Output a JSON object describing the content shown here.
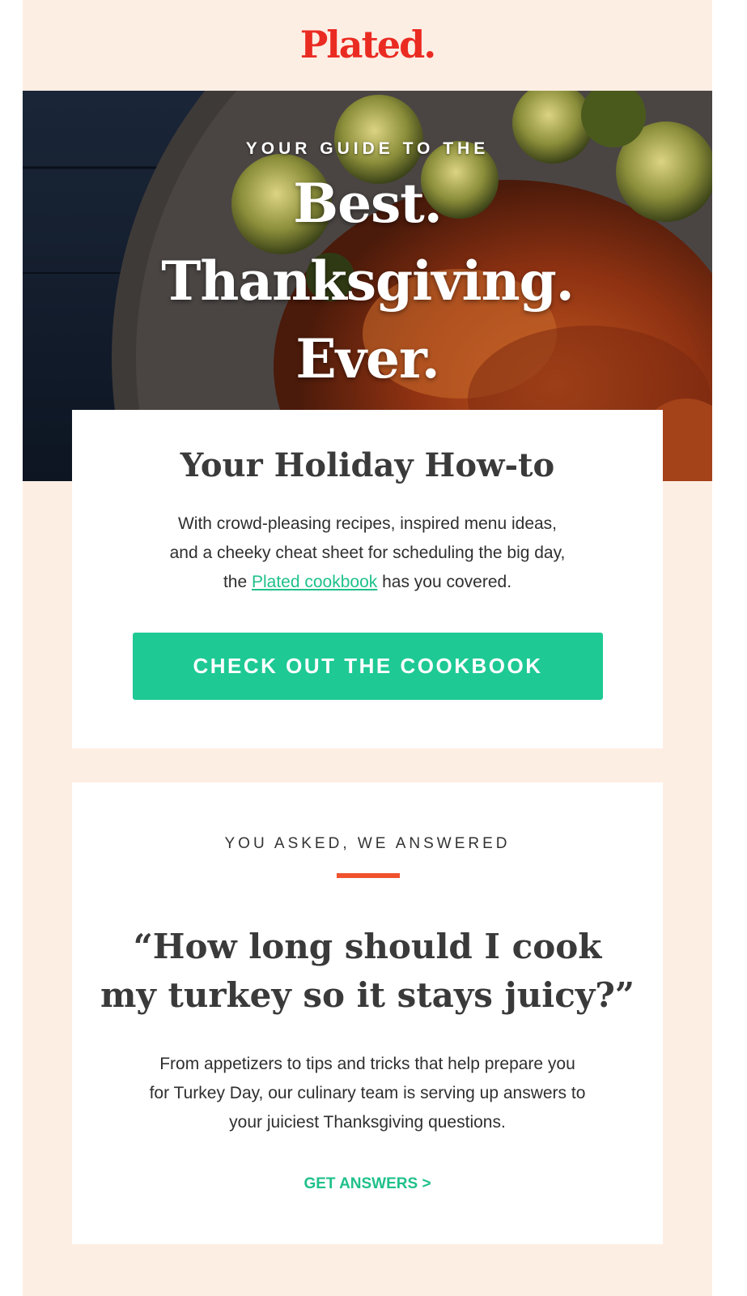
{
  "brand": {
    "logo": "Plated.",
    "color": "#ea2b22",
    "accent": "#1ec994"
  },
  "hero": {
    "eyebrow": "YOUR GUIDE TO THE",
    "line1": "Best.",
    "line2": "Thanksgiving.",
    "line3": "Ever.",
    "image_icon": "roast-turkey-brussels-sprouts-image"
  },
  "holiday": {
    "title": "Your Holiday How-to",
    "line1": "With crowd-pleasing recipes, inspired menu ideas,",
    "line2": "and a cheeky cheat sheet for scheduling the big day,",
    "line3_before": "the ",
    "line3_link": "Plated cookbook",
    "line3_after": " has you covered.",
    "cta": "CHECK OUT THE COOKBOOK"
  },
  "faq": {
    "eyebrow": "YOU ASKED, WE ANSWERED",
    "quote1": "“How long should I cook",
    "quote2": "my turkey so it stays juicy?”",
    "line1": "From appetizers to tips and tricks that help prepare you",
    "line2": "for Turkey Day, our culinary team is serving up answers to",
    "line3": "your juiciest Thanksgiving questions.",
    "link": "GET ANSWERS >"
  }
}
